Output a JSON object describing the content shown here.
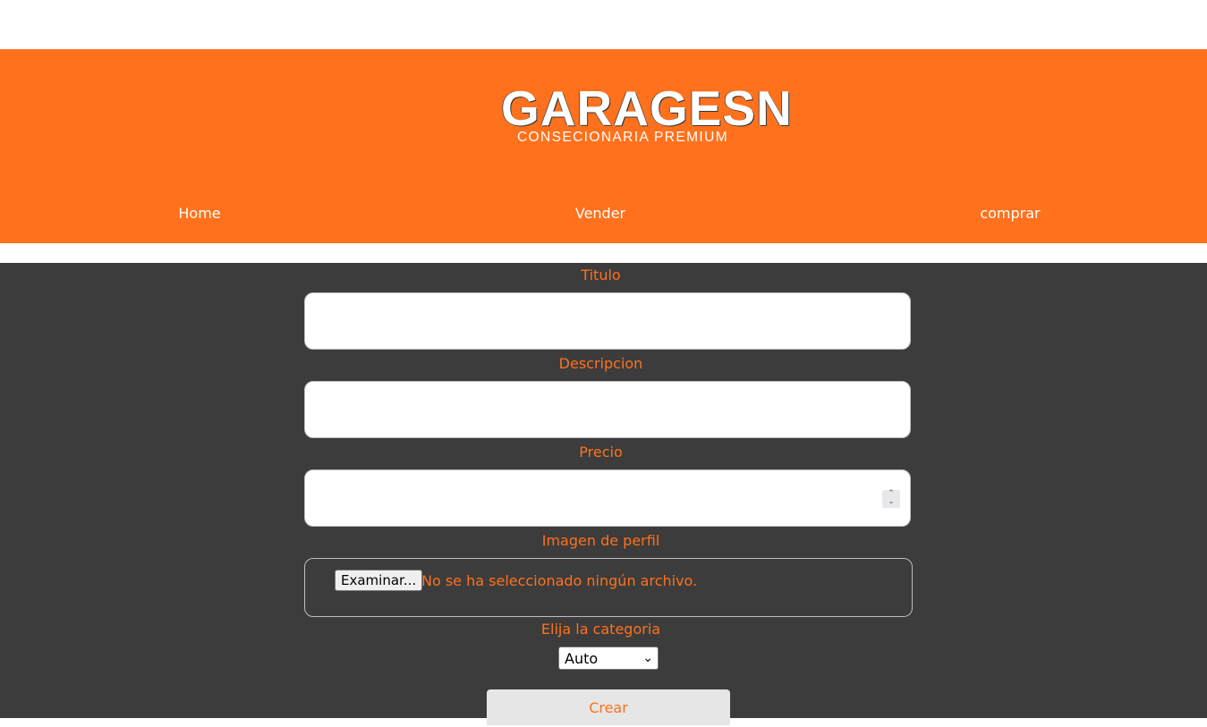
{
  "brand": {
    "logo_text": "GARAGESN",
    "tagline": "CONSECIONARIA PREMIUM"
  },
  "nav": {
    "home": "Home",
    "vender": "Vender",
    "comprar": "comprar"
  },
  "form": {
    "titulo_label": "Titulo",
    "descripcion_label": "Descripcion",
    "precio_label": "Precio",
    "imagen_label": "Imagen de perfil",
    "file_button": "Examinar...",
    "file_status": "No se ha seleccionado ningún archivo.",
    "categoria_label": "Elija la categoria",
    "categoria_value": "Auto",
    "submit_label": "Crear"
  },
  "colors": {
    "accent": "#ff711c",
    "form_background": "#3c3c3c",
    "page_background": "#ffffff"
  }
}
